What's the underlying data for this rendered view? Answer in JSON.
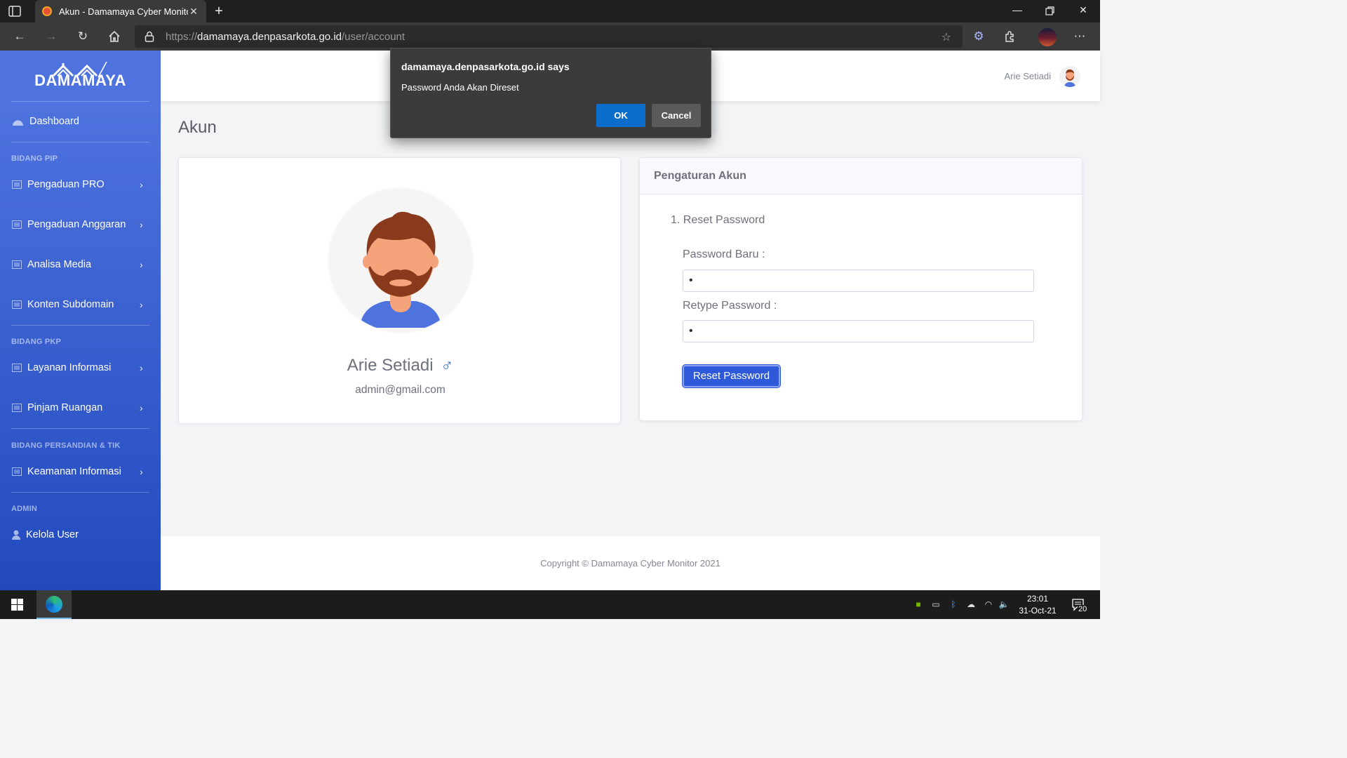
{
  "browser": {
    "tab_title": "Akun - Damamaya Cyber Monito",
    "tab_close": "✕",
    "new_tab": "+",
    "url_scheme": "https://",
    "url_host": "damamaya.denpasarkota.go.id",
    "url_path": "/user/account",
    "icons": [
      "tab-actions-icon",
      "back-icon",
      "forward-icon",
      "refresh-icon",
      "home-icon",
      "lock-icon",
      "favorite-icon",
      "extension-gear-icon",
      "extensions-icon",
      "profile-avatar",
      "more-icon"
    ]
  },
  "sidebar": {
    "brand": "DAMAMAYA",
    "dashboard": "Dashboard",
    "sections": [
      {
        "heading": "BIDANG PIP",
        "items": [
          "Pengaduan PRO",
          "Pengaduan Anggaran",
          "Analisa Media",
          "Konten Subdomain"
        ]
      },
      {
        "heading": "BIDANG PKP",
        "items": [
          "Layanan Informasi",
          "Pinjam Ruangan"
        ]
      },
      {
        "heading": "BIDANG PERSANDIAN & TIK",
        "items": [
          "Keamanan Informasi"
        ]
      },
      {
        "heading": "ADMIN",
        "items": [
          "Kelola User"
        ]
      }
    ]
  },
  "topbar": {
    "user_name": "Arie Setiadi"
  },
  "page": {
    "title": "Akun"
  },
  "profile": {
    "name": "Arie Setiadi",
    "gender_symbol": "♂",
    "email": "admin@gmail.com"
  },
  "settings": {
    "header": "Pengaturan Akun",
    "step": "1. Reset Password",
    "new_password_label": "Password Baru :",
    "new_password_value": "•",
    "retype_password_label": "Retype Password :",
    "retype_password_value": "•",
    "reset_button": "Reset Password"
  },
  "footer": {
    "copyright": "Copyright © Damamaya Cyber Monitor 2021"
  },
  "dialog": {
    "title": "damamaya.denpasarkota.go.id says",
    "message": "Password Anda Akan Direset",
    "ok": "OK",
    "cancel": "Cancel"
  },
  "taskbar": {
    "time": "23:01",
    "date": "31-Oct-21",
    "notification_count": "20"
  },
  "colors": {
    "sidebar_top": "#4e73df",
    "sidebar_bottom": "#224abe",
    "primary_button": "#2e59d9",
    "dialog_ok": "#0b6cc9"
  }
}
